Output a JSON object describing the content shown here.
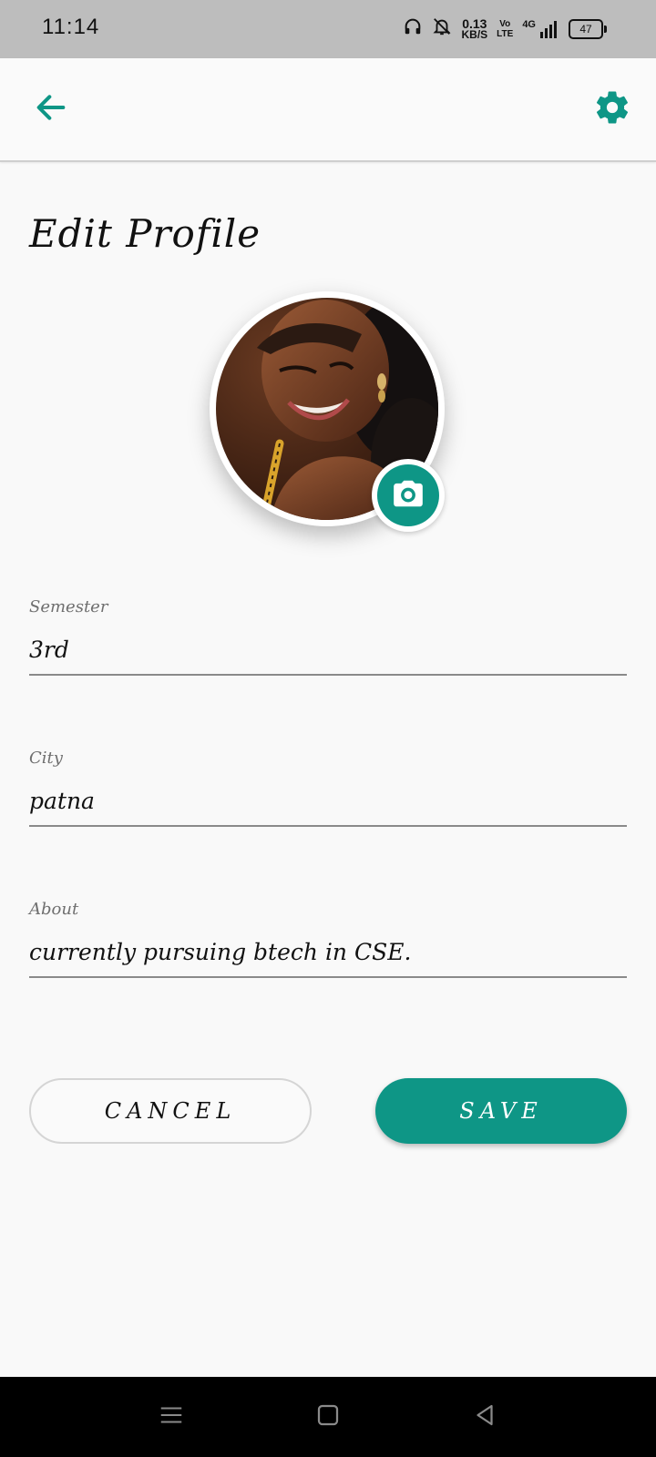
{
  "status_bar": {
    "time": "11:14",
    "net_speed_value": "0.13",
    "net_speed_unit": "KB/S",
    "volte_top": "Vo",
    "volte_bottom": "LTE",
    "network": "4G",
    "battery": "47",
    "icons": [
      "headphones-icon",
      "bell-off-icon",
      "signal-icon",
      "battery-icon"
    ]
  },
  "app_bar": {
    "back_icon": "arrow-left-icon",
    "settings_icon": "gear-icon",
    "accent_color": "#0e9686"
  },
  "page": {
    "title": "Edit Profile"
  },
  "profile": {
    "camera_icon": "camera-icon"
  },
  "form": {
    "semester": {
      "label": "Semester",
      "value": "3rd"
    },
    "city": {
      "label": "City",
      "value": "patna"
    },
    "about": {
      "label": "About",
      "value": "currently pursuing btech in CSE."
    }
  },
  "actions": {
    "cancel_label": "CANCEL",
    "save_label": "SAVE",
    "save_color": "#0e9686"
  },
  "nav_bar": {
    "icons": [
      "menu-icon",
      "home-icon",
      "back-triangle-icon"
    ]
  }
}
